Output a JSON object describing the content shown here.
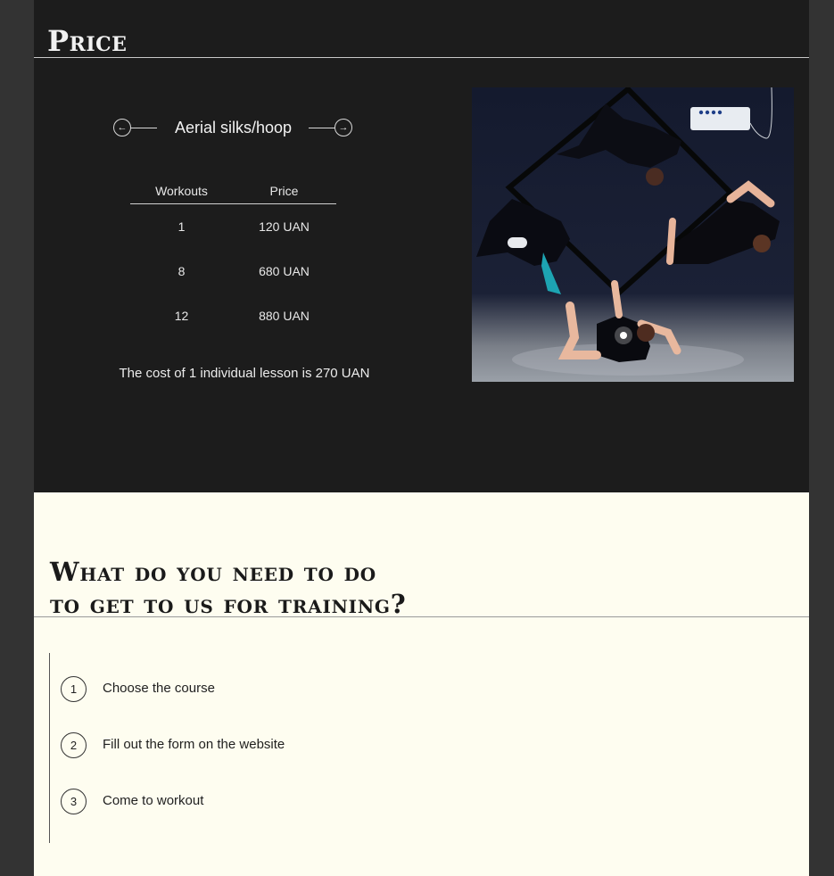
{
  "price": {
    "title": "Price",
    "course": {
      "name": "Aerial silks/hoop",
      "prev_icon": "arrow-left-icon",
      "next_icon": "arrow-right-icon"
    },
    "table": {
      "headers": [
        "Workouts",
        "Price"
      ],
      "rows": [
        {
          "workouts": "1",
          "price": "120 UAN"
        },
        {
          "workouts": "8",
          "price": "680 UAN"
        },
        {
          "workouts": "12",
          "price": "880 UAN"
        }
      ]
    },
    "note": "The cost of 1 individual lesson is 270 UAN"
  },
  "steps": {
    "title_line1": "What do you need to do",
    "title_line2": "to get to us for training?",
    "items": [
      {
        "number": "1",
        "label": "Choose the course"
      },
      {
        "number": "2",
        "label": "Fill out the form on the website"
      },
      {
        "number": "3",
        "label": "Come to workout"
      }
    ]
  },
  "colors": {
    "dark_bg": "#1c1c1c",
    "outer_bg": "#333333",
    "light_bg": "#fefdf0"
  }
}
